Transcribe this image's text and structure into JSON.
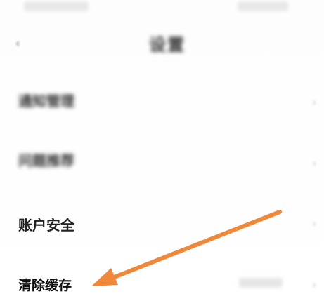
{
  "nav": {
    "back_icon": "‹",
    "title": "设置"
  },
  "menu": [
    {
      "label": "通知管理",
      "chevron": "›"
    },
    {
      "label": "问题推荐",
      "chevron": "›"
    },
    {
      "label": "账户安全",
      "chevron": "›"
    },
    {
      "label": "清除缓存",
      "chevron": "›"
    }
  ],
  "annotation": {
    "arrow_color": "#f0883a",
    "arrow_target": "clear-cache-item"
  }
}
